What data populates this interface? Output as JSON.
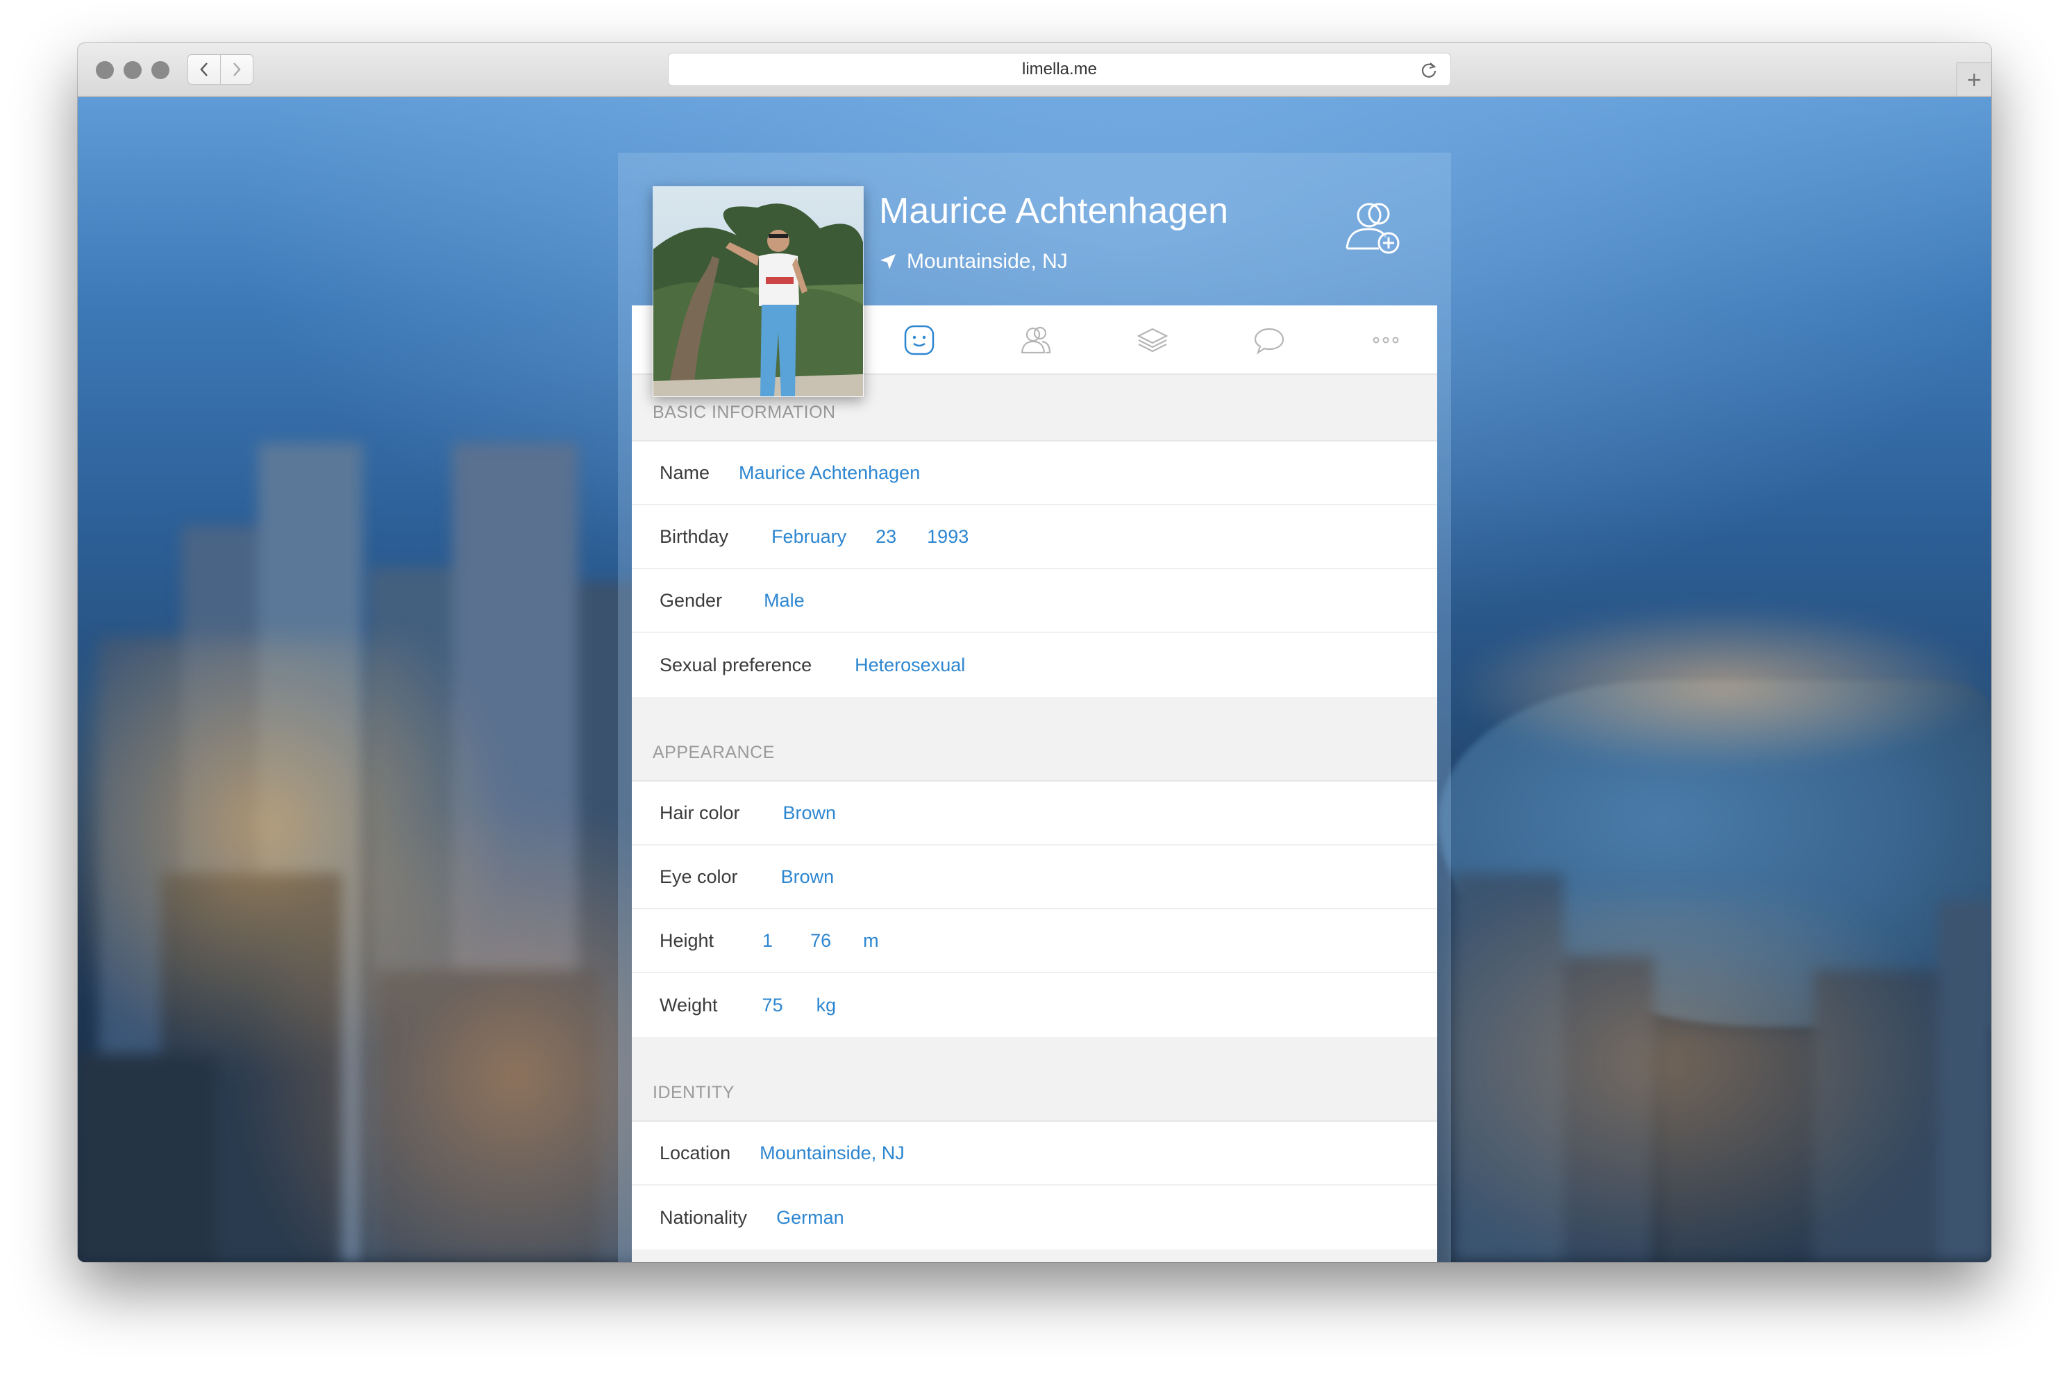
{
  "browser": {
    "url": "limella.me"
  },
  "profile": {
    "name": "Maurice Achtenhagen",
    "location": "Mountainside, NJ"
  },
  "tabs": [
    {
      "id": "about",
      "icon": "smiley-icon",
      "active": true
    },
    {
      "id": "friends",
      "icon": "people-icon",
      "active": false
    },
    {
      "id": "stack",
      "icon": "layers-icon",
      "active": false
    },
    {
      "id": "messages",
      "icon": "speech-bubble-icon",
      "active": false
    },
    {
      "id": "more",
      "icon": "more-dots-icon",
      "active": false
    }
  ],
  "sections": {
    "basic": {
      "title": "BASIC INFORMATION",
      "name_label": "Name",
      "name_value": "Maurice Achtenhagen",
      "birthday_label": "Birthday",
      "birthday_month": "February",
      "birthday_day": "23",
      "birthday_year": "1993",
      "gender_label": "Gender",
      "gender_value": "Male",
      "pref_label": "Sexual preference",
      "pref_value": "Heterosexual"
    },
    "appearance": {
      "title": "APPEARANCE",
      "hair_label": "Hair color",
      "hair_value": "Brown",
      "eye_label": "Eye color",
      "eye_value": "Brown",
      "height_label": "Height",
      "height_m": "1",
      "height_cm": "76",
      "height_unit": "m",
      "weight_label": "Weight",
      "weight_value": "75",
      "weight_unit": "kg"
    },
    "identity": {
      "title": "IDENTITY",
      "location_label": "Location",
      "location_value": "Mountainside, NJ",
      "nationality_label": "Nationality",
      "nationality_value": "German"
    }
  },
  "colors": {
    "accent": "#2d86d0",
    "label": "#3b3b3b",
    "section_title": "#9a9a9a"
  }
}
